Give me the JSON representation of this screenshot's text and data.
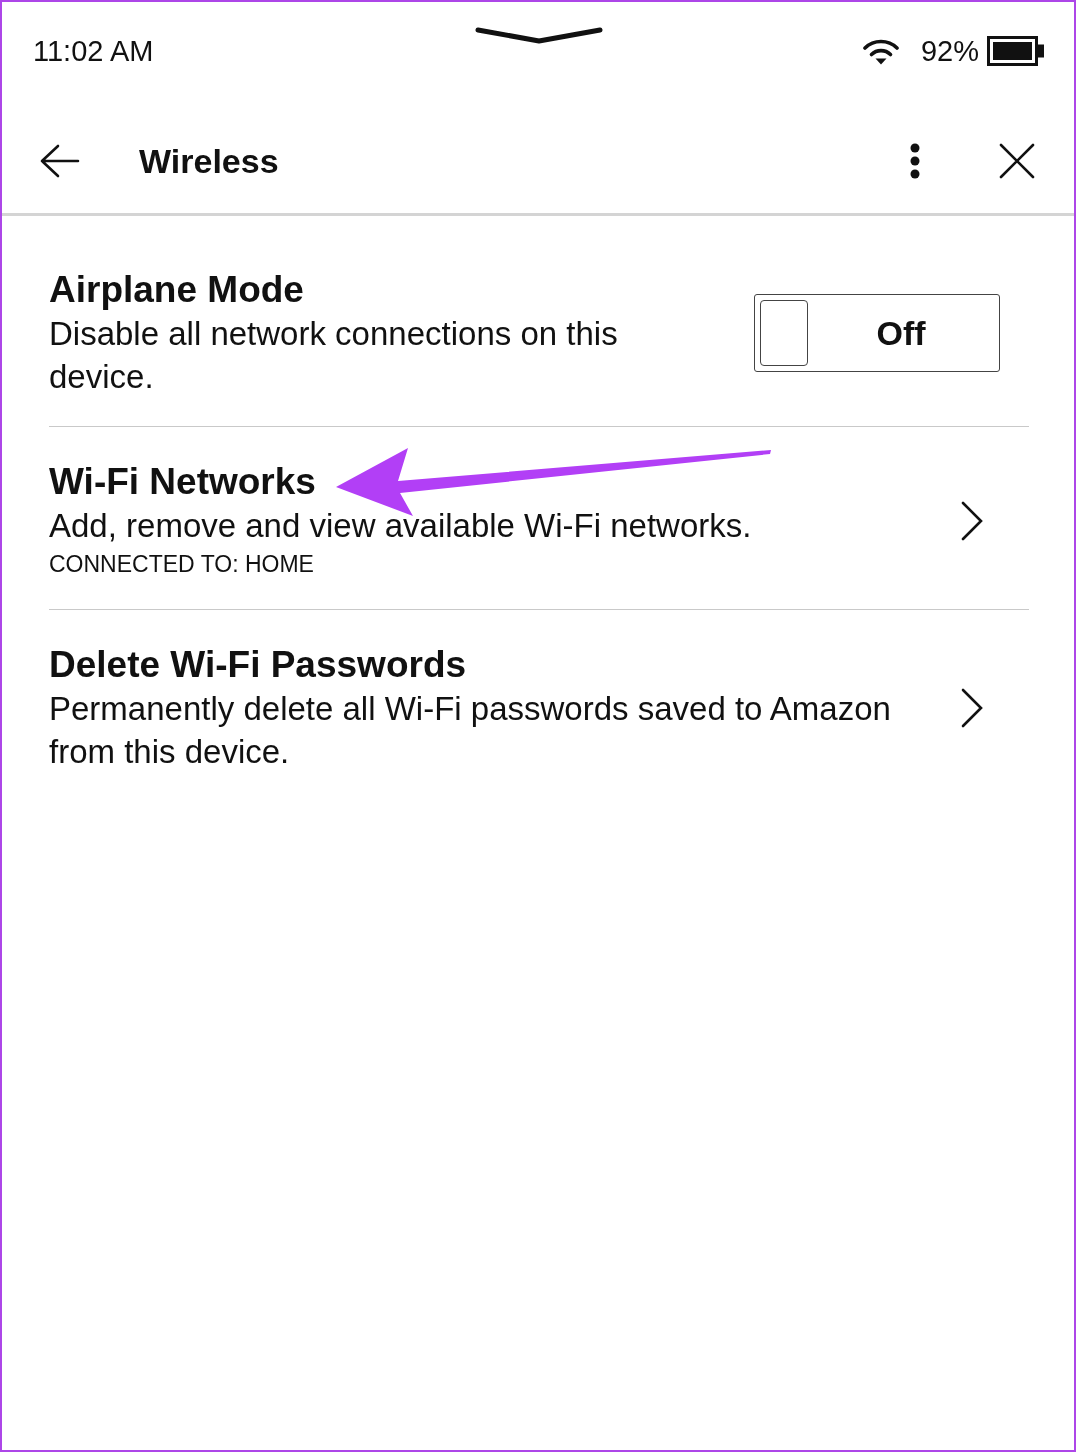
{
  "status_bar": {
    "time": "11:02 AM",
    "battery": "92%"
  },
  "header": {
    "title": "Wireless"
  },
  "settings": [
    {
      "kind": "toggle",
      "title": "Airplane Mode",
      "description": "Disable all network connections on this device.",
      "on": false,
      "state_label": "Off",
      "pointer_arrow": false
    },
    {
      "kind": "link",
      "title": "Wi-Fi Networks",
      "description": "Add, remove and view available Wi-Fi networks.",
      "status": "CONNECTED TO: HOME",
      "pointer_arrow": true
    },
    {
      "kind": "link",
      "title": "Delete Wi-Fi Passwords",
      "description": "Permanently delete all Wi-Fi passwords saved to Amazon from this device.",
      "pointer_arrow": false
    }
  ]
}
